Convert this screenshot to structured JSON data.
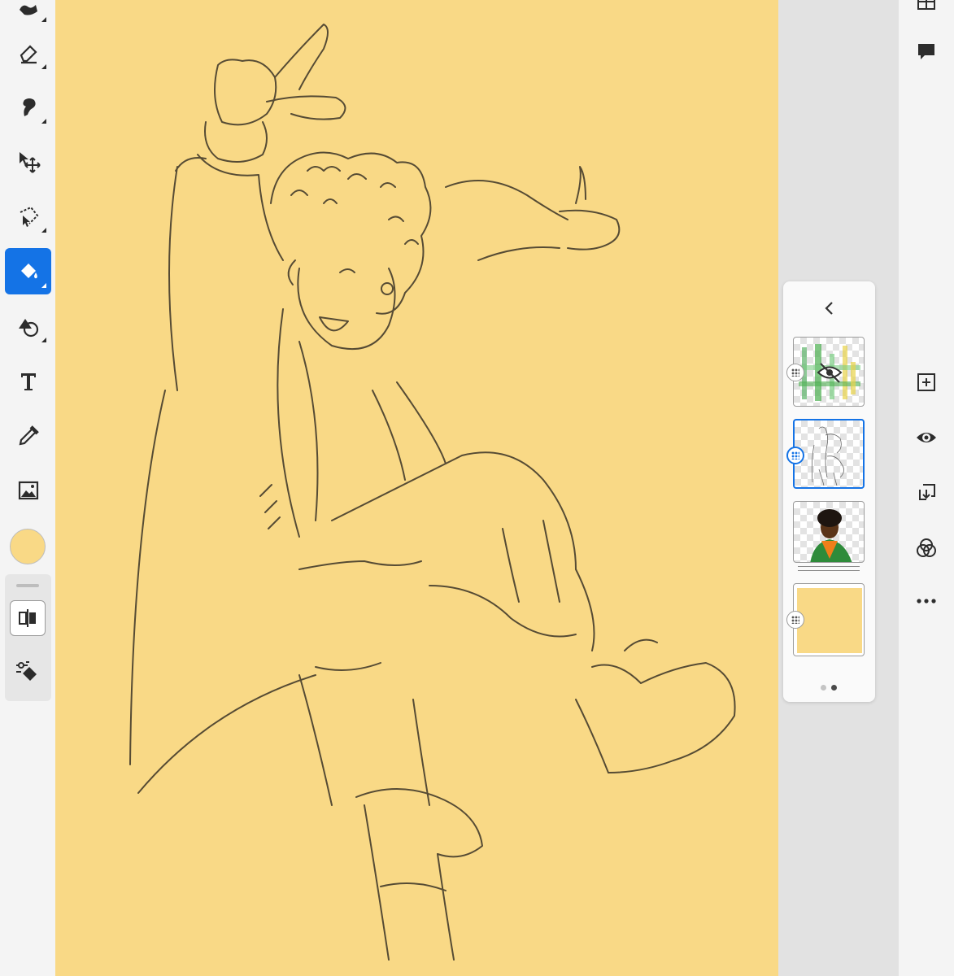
{
  "canvas": {
    "background_color": "#f9d986"
  },
  "left_toolbar": {
    "tools": [
      {
        "name": "brush-tool",
        "icon": "brush-icon",
        "active": false
      },
      {
        "name": "eraser-tool",
        "icon": "eraser-icon",
        "active": false
      },
      {
        "name": "smudge-tool",
        "icon": "smudge-icon",
        "active": false
      },
      {
        "name": "transform-tool",
        "icon": "move-icon",
        "active": false
      },
      {
        "name": "lasso-tool",
        "icon": "lasso-icon",
        "active": false
      },
      {
        "name": "fill-tool",
        "icon": "paint-bucket-icon",
        "active": true
      },
      {
        "name": "shapes-tool",
        "icon": "shapes-icon",
        "active": false
      },
      {
        "name": "text-tool",
        "icon": "text-icon",
        "active": false
      },
      {
        "name": "eyedropper-tool",
        "icon": "eyedropper-icon",
        "active": false
      },
      {
        "name": "image-tool",
        "icon": "image-icon",
        "active": false
      }
    ],
    "current_color": "#f9d986",
    "accent_color": "#1473e6"
  },
  "layers_panel": {
    "layers": [
      {
        "name": "layer-color-grid",
        "hidden": true,
        "selected": false
      },
      {
        "name": "layer-sketch",
        "hidden": false,
        "selected": true
      },
      {
        "name": "layer-character-color",
        "hidden": false,
        "selected": false
      },
      {
        "name": "layer-background",
        "hidden": false,
        "selected": false
      }
    ],
    "pages": 2,
    "current_page": 2
  },
  "right_toolbar": {
    "tools": [
      "grid-icon",
      "comment-icon",
      "add-layer-icon",
      "visibility-icon",
      "merge-down-icon",
      "blend-icon",
      "more-icon"
    ]
  }
}
